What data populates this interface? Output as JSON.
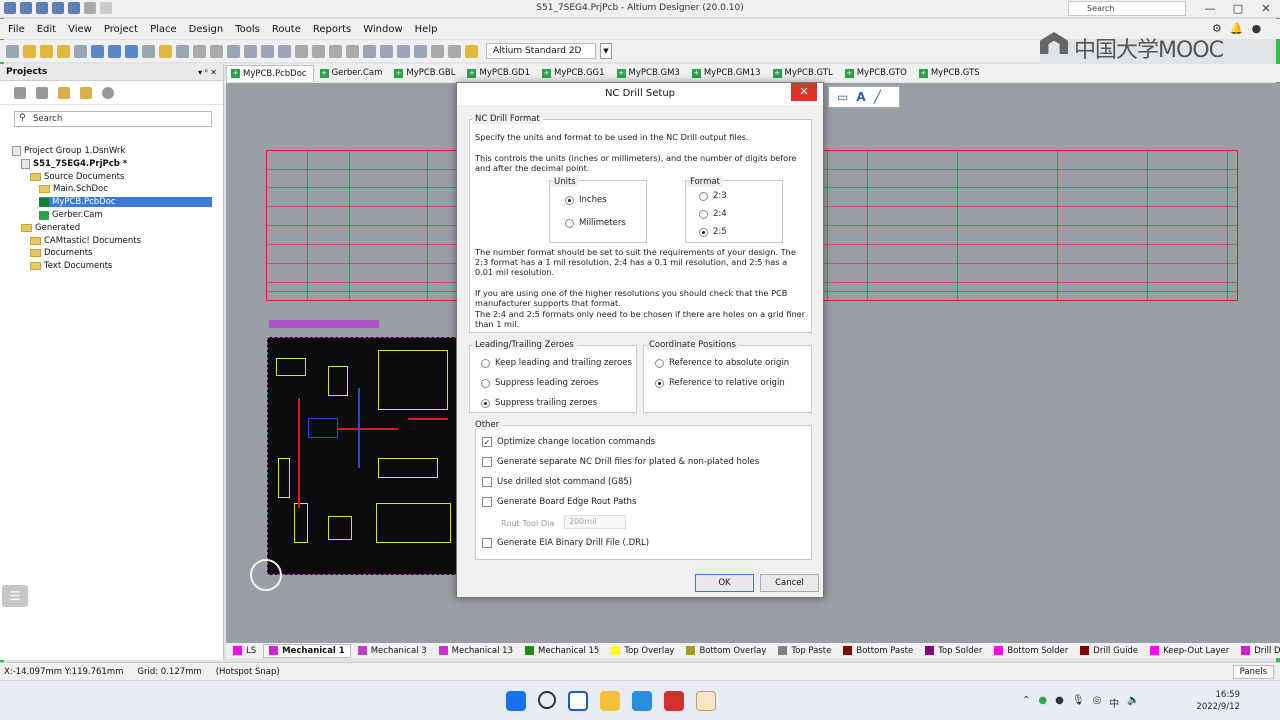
{
  "window": {
    "title": "S51_7SEG4.PrjPcb - Altium Designer (20.0.10)",
    "search_placeholder": "Search",
    "view_mode": "Altium Standard 2D"
  },
  "watermark": "中国大学MOOC",
  "menu": [
    "File",
    "Edit",
    "View",
    "Project",
    "Place",
    "Design",
    "Tools",
    "Route",
    "Reports",
    "Window",
    "Help"
  ],
  "doc_tabs": [
    "MyPCB.PcbDoc",
    "Gerber.Cam",
    "MyPCB.GBL",
    "MyPCB.GD1",
    "MyPCB.GG1",
    "MyPCB.GM3",
    "MyPCB.GM13",
    "MyPCB.GTL",
    "MyPCB.GTO",
    "MyPCB.GTS"
  ],
  "projects": {
    "header": "Projects",
    "search_placeholder": "Search",
    "tree": [
      {
        "label": "Project Group 1.DsnWrk",
        "icon": "workspace-icon",
        "indent": 0
      },
      {
        "label": "S51_7SEG4.PrjPcb *",
        "icon": "project-icon",
        "indent": 1,
        "bold": true
      },
      {
        "label": "Source Documents",
        "icon": "folder-icon",
        "indent": 2
      },
      {
        "label": "Main.SchDoc",
        "icon": "folder-icon",
        "indent": 3
      },
      {
        "label": "MyPCB.PcbDoc",
        "icon": "pcb-file-icon",
        "indent": 3,
        "selected": true
      },
      {
        "label": "Gerber.Cam",
        "icon": "cam-file-icon",
        "indent": 3
      },
      {
        "label": "Generated",
        "icon": "folder-icon",
        "indent": 1
      },
      {
        "label": "CAMtastic! Documents",
        "icon": "folder-icon",
        "indent": 2
      },
      {
        "label": "Documents",
        "icon": "folder-icon",
        "indent": 2
      },
      {
        "label": "Text Documents",
        "icon": "folder-icon",
        "indent": 2
      }
    ]
  },
  "dialog": {
    "title": "NC Drill Setup",
    "format_group": "NC Drill Format",
    "intro1": "Specify the units and format to be used in the NC Drill output files.",
    "intro2": "This controls the units (inches or millimeters), and the number of digits before and after the decimal point.",
    "units_label": "Units",
    "units": [
      {
        "label": "Inches",
        "checked": true
      },
      {
        "label": "Millimeters",
        "checked": false
      }
    ],
    "format_label": "Format",
    "formats": [
      {
        "label": "2:3",
        "checked": false
      },
      {
        "label": "2:4",
        "checked": false
      },
      {
        "label": "2:5",
        "checked": true
      }
    ],
    "note1": "The number format should be set to suit the requirements of your design. The 2:3 format has a 1 mil resolution, 2:4 has a 0.1 mil resolution, and 2:5 has a 0.01 mil resolution.",
    "note2": "If you are using one of the higher resolutions you should check that the PCB manufacturer supports that format.",
    "note3": "The 2:4 and 2:5 formats only need to be chosen if there are holes on a grid finer than 1 mil.",
    "zeroes_label": "Leading/Trailing Zeroes",
    "zeroes": [
      {
        "label": "Keep leading and trailing zeroes",
        "checked": false
      },
      {
        "label": "Suppress leading zeroes",
        "checked": false
      },
      {
        "label": "Suppress trailing zeroes",
        "checked": true
      }
    ],
    "coord_label": "Coordinate Positions",
    "coords": [
      {
        "label": "Reference to absolute origin",
        "checked": false
      },
      {
        "label": "Reference to relative origin",
        "checked": true
      }
    ],
    "other_label": "Other",
    "other": [
      {
        "label": "Optimize change location commands",
        "checked": true
      },
      {
        "label": "Generate separate NC Drill files for plated & non-plated holes",
        "checked": false
      },
      {
        "label": "Use drilled slot command (G85)",
        "checked": false
      },
      {
        "label": "Generate Board Edge Rout Paths",
        "checked": false
      }
    ],
    "rout_label": "Rout Tool Dia",
    "rout_value": "200mil",
    "eia_label": "Generate EIA Binary Drill File (.DRL)",
    "eia_checked": false,
    "ok": "OK",
    "cancel": "Cancel"
  },
  "layer_tabs": [
    {
      "label": "LS",
      "color": "#ff00ff"
    },
    {
      "label": "Mechanical 1",
      "color": "#d020d0",
      "active": true
    },
    {
      "label": "Mechanical 3",
      "color": "#c040c0"
    },
    {
      "label": "Mechanical 13",
      "color": "#d030d0"
    },
    {
      "label": "Mechanical 15",
      "color": "#208a20"
    },
    {
      "label": "Top Overlay",
      "color": "#ffff00"
    },
    {
      "label": "Bottom Overlay",
      "color": "#a0a020"
    },
    {
      "label": "Top Paste",
      "color": "#808080"
    },
    {
      "label": "Bottom Paste",
      "color": "#800000"
    },
    {
      "label": "Top Solder",
      "color": "#800080"
    },
    {
      "label": "Bottom Solder",
      "color": "#ff00ff"
    },
    {
      "label": "Drill Guide",
      "color": "#800000"
    },
    {
      "label": "Keep-Out Layer",
      "color": "#ff00ff"
    },
    {
      "label": "Drill Dr",
      "color": "#d020d0"
    }
  ],
  "status": {
    "coords": "X:-14.097mm Y:119.761mm",
    "grid": "Grid: 0.127mm",
    "snap": "(Hotspot Snap)",
    "panels": "Panels"
  },
  "clock": {
    "time": "16:59",
    "date": "2022/9/12"
  },
  "tray_ime": "中"
}
